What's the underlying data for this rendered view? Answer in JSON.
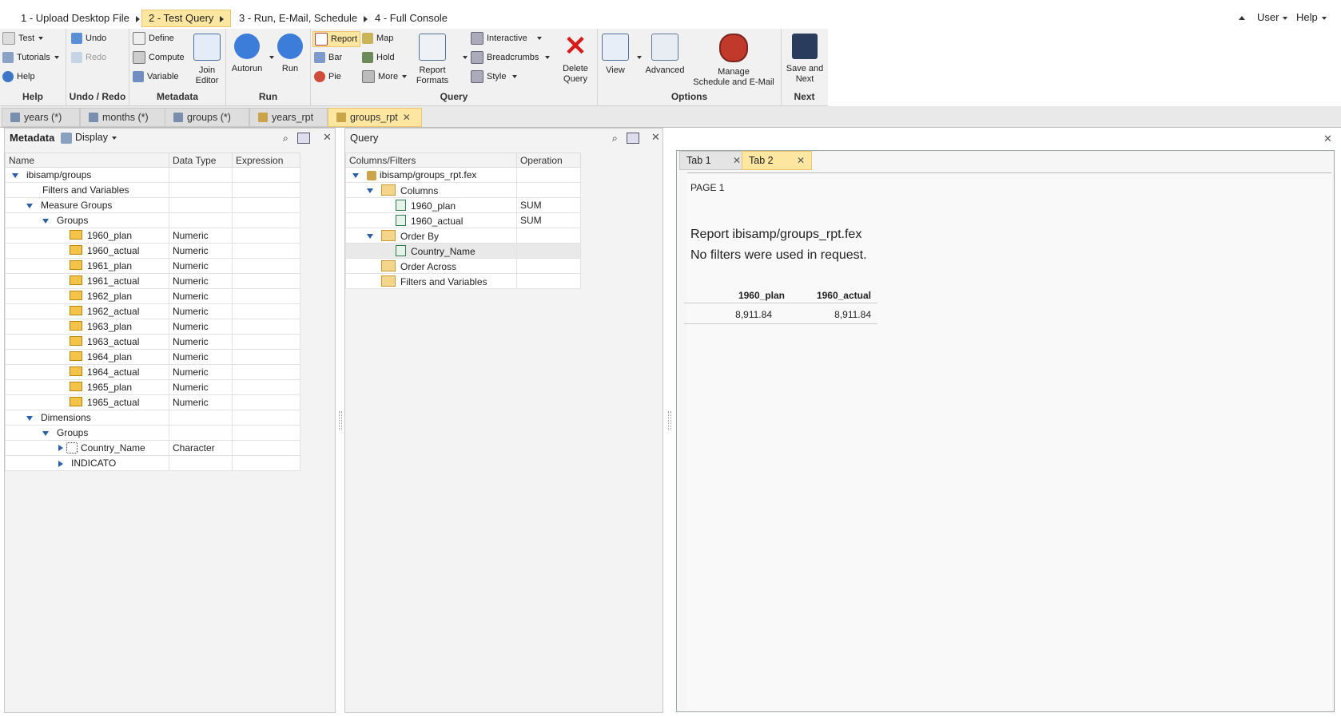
{
  "steps": [
    {
      "label": "1 - Upload Desktop File"
    },
    {
      "label": "2 - Test Query"
    },
    {
      "label": "3 - Run, E-Mail, Schedule"
    },
    {
      "label": "4 - Full Console"
    }
  ],
  "usermenu": {
    "user": "User",
    "help": "Help"
  },
  "ribbon": {
    "help": {
      "title": "Help",
      "test": "Test",
      "tutorials": "Tutorials",
      "help": "Help"
    },
    "undo": {
      "title": "Undo / Redo",
      "undo": "Undo",
      "redo": "Redo"
    },
    "metadata": {
      "title": "Metadata",
      "define": "Define",
      "compute": "Compute",
      "variable": "Variable",
      "join_editor": "Join\nEditor"
    },
    "run": {
      "title": "Run",
      "autorun": "Autorun",
      "run": "Run"
    },
    "query": {
      "title": "Query",
      "report": "Report",
      "bar": "Bar",
      "pie": "Pie",
      "map": "Map",
      "hold": "Hold",
      "more": "More",
      "report_formats": "Report\nFormats",
      "interactive": "Interactive",
      "breadcrumbs": "Breadcrumbs",
      "style": "Style",
      "delete_query": "Delete\nQuery"
    },
    "options": {
      "title": "Options",
      "view": "View",
      "advanced": "Advanced",
      "manage": "Manage\nSchedule and E-Mail"
    },
    "next": {
      "title": "Next",
      "save_next": "Save and\nNext"
    }
  },
  "doc_tabs": [
    {
      "label": "years (*)"
    },
    {
      "label": "months (*)"
    },
    {
      "label": "groups (*)"
    },
    {
      "label": "years_rpt"
    },
    {
      "label": "groups_rpt"
    }
  ],
  "metadata_panel": {
    "title": "Metadata",
    "display": "Display",
    "headers": [
      "Name",
      "Data Type",
      "Expression"
    ],
    "rows": [
      {
        "name": "ibisamp/groups",
        "type": ""
      },
      {
        "name": "Filters and Variables",
        "type": ""
      },
      {
        "name": "Measure Groups",
        "type": ""
      },
      {
        "name": "Groups",
        "type": ""
      },
      {
        "name": "1960_plan",
        "type": "Numeric"
      },
      {
        "name": "1960_actual",
        "type": "Numeric"
      },
      {
        "name": "1961_plan",
        "type": "Numeric"
      },
      {
        "name": "1961_actual",
        "type": "Numeric"
      },
      {
        "name": "1962_plan",
        "type": "Numeric"
      },
      {
        "name": "1962_actual",
        "type": "Numeric"
      },
      {
        "name": "1963_plan",
        "type": "Numeric"
      },
      {
        "name": "1963_actual",
        "type": "Numeric"
      },
      {
        "name": "1964_plan",
        "type": "Numeric"
      },
      {
        "name": "1964_actual",
        "type": "Numeric"
      },
      {
        "name": "1965_plan",
        "type": "Numeric"
      },
      {
        "name": "1965_actual",
        "type": "Numeric"
      },
      {
        "name": "Dimensions",
        "type": ""
      },
      {
        "name": "Groups",
        "type": ""
      },
      {
        "name": "Country_Name",
        "type": "Character"
      },
      {
        "name": "INDICATO",
        "type": ""
      }
    ]
  },
  "query_panel": {
    "title": "Query",
    "headers": [
      "Columns/Filters",
      "Operation"
    ],
    "rows": [
      {
        "name": "ibisamp/groups_rpt.fex",
        "op": ""
      },
      {
        "name": "Columns",
        "op": ""
      },
      {
        "name": "1960_plan",
        "op": "SUM"
      },
      {
        "name": "1960_actual",
        "op": "SUM"
      },
      {
        "name": "Order By",
        "op": ""
      },
      {
        "name": "Country_Name",
        "op": ""
      },
      {
        "name": "Order Across",
        "op": ""
      },
      {
        "name": "Filters and Variables",
        "op": ""
      }
    ]
  },
  "output": {
    "tabs": [
      {
        "label": "Tab 1"
      },
      {
        "label": "Tab 2"
      }
    ],
    "page": "PAGE 1",
    "line1": "Report ibisamp/groups_rpt.fex",
    "line2": "No filters were used in request.",
    "table": {
      "headers": [
        "1960_plan",
        "1960_actual"
      ],
      "values": [
        "8,911.84",
        "8,911.84"
      ]
    }
  },
  "colors": {
    "accent": "#fde7a0",
    "accent_border": "#f0c36d",
    "tree_arrow": "#2b5fa8"
  }
}
